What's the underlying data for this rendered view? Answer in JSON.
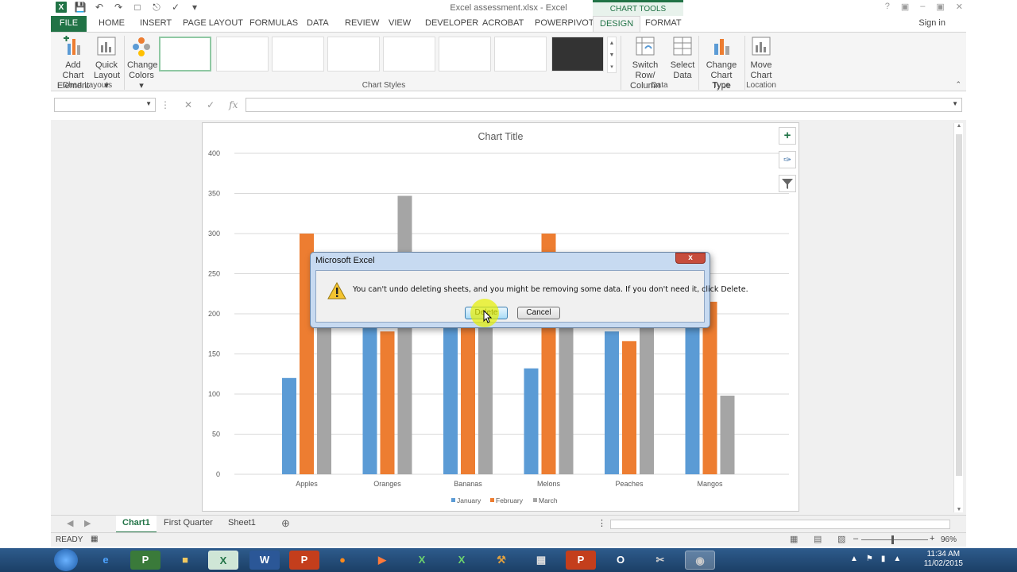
{
  "titlebar": {
    "title": "Excel assessment.xlsx - Excel",
    "context_group": "CHART TOOLS",
    "signin": "Sign in"
  },
  "tabs": {
    "file": "FILE",
    "items": [
      "HOME",
      "INSERT",
      "PAGE LAYOUT",
      "FORMULAS",
      "DATA",
      "REVIEW",
      "VIEW",
      "DEVELOPER",
      "ACROBAT",
      "POWERPIVOT"
    ],
    "design": "DESIGN",
    "format": "FORMAT"
  },
  "ribbon": {
    "add_chart_element": [
      "Add Chart",
      "Element"
    ],
    "quick_layout": [
      "Quick",
      "Layout"
    ],
    "change_colors": [
      "Change",
      "Colors"
    ],
    "switch_row_column": [
      "Switch Row/",
      "Column"
    ],
    "select_data": [
      "Select",
      "Data"
    ],
    "change_chart_type": [
      "Change",
      "Chart Type"
    ],
    "move_chart": [
      "Move",
      "Chart"
    ],
    "groups": {
      "chart_layouts": "Chart Layouts",
      "chart_styles": "Chart Styles",
      "data": "Data",
      "type": "Type",
      "location": "Location"
    }
  },
  "formula_bar": {
    "name_box_value": "",
    "formula_value": "",
    "fx": "fx"
  },
  "chart_data": {
    "type": "bar",
    "title": "Chart Title",
    "categories": [
      "Apples",
      "Oranges",
      "Bananas",
      "Melons",
      "Peaches",
      "Mangos"
    ],
    "series": [
      {
        "name": "January",
        "color": "#5b9bd5",
        "values": [
          120,
          190,
          190,
          132,
          178,
          190
        ]
      },
      {
        "name": "February",
        "color": "#ed7d31",
        "values": [
          300,
          178,
          190,
          300,
          166,
          215
        ]
      },
      {
        "name": "March",
        "color": "#a5a5a5",
        "values": [
          190,
          347,
          190,
          190,
          190,
          98
        ]
      }
    ],
    "ylim": [
      0,
      400
    ],
    "yticks": [
      "0",
      "50",
      "100",
      "150",
      "200",
      "250",
      "300",
      "350",
      "400"
    ],
    "grid": true,
    "legend": "bottom"
  },
  "dialog": {
    "title": "Microsoft Excel",
    "message": "You can't undo deleting sheets, and you might be removing some data. If you don't need it, click Delete.",
    "delete_label": "Delete",
    "cancel_label": "Cancel",
    "close_label": "x"
  },
  "sheet_tabs": [
    "Chart1",
    "First Quarter",
    "Sheet1"
  ],
  "status": {
    "ready": "READY",
    "zoom": "96%"
  },
  "taskbar": {
    "time": "11:34 AM",
    "date": "11/02/2015"
  }
}
